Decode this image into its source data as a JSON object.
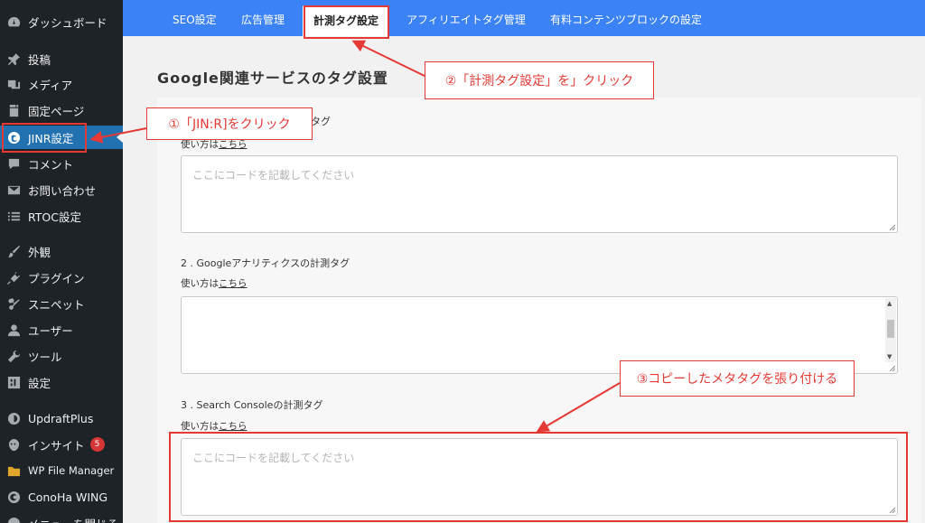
{
  "sidebar": {
    "items": [
      {
        "label": "ダッシュボード",
        "icon": "dashboard-icon"
      },
      {
        "label": "投稿",
        "icon": "pin-icon"
      },
      {
        "label": "メディア",
        "icon": "media-icon"
      },
      {
        "label": "固定ページ",
        "icon": "page-icon"
      },
      {
        "label": "JINR設定",
        "icon": "jinr-icon"
      },
      {
        "label": "コメント",
        "icon": "comment-icon"
      },
      {
        "label": "お問い合わせ",
        "icon": "mail-icon"
      },
      {
        "label": "RTOC設定",
        "icon": "list-icon"
      },
      {
        "label": "外観",
        "icon": "brush-icon"
      },
      {
        "label": "プラグイン",
        "icon": "plugin-icon"
      },
      {
        "label": "スニペット",
        "icon": "scissors-icon"
      },
      {
        "label": "ユーザー",
        "icon": "user-icon"
      },
      {
        "label": "ツール",
        "icon": "wrench-icon"
      },
      {
        "label": "設定",
        "icon": "settings-icon"
      },
      {
        "label": "UpdraftPlus",
        "icon": "updraft-icon"
      },
      {
        "label": "インサイト",
        "icon": "insight-icon",
        "badge": "5"
      },
      {
        "label": "WP File Manager",
        "icon": "folder-icon"
      },
      {
        "label": "ConoHa WING",
        "icon": "conoha-icon"
      },
      {
        "label": "メニューを閉じる",
        "icon": "collapse-icon"
      }
    ]
  },
  "tabs": [
    {
      "label": "SEO設定"
    },
    {
      "label": "広告管理"
    },
    {
      "label": "計測タグ設定"
    },
    {
      "label": "アフィリエイトタグ管理"
    },
    {
      "label": "有料コンテンツブロックの設定"
    }
  ],
  "main": {
    "title": "Google関連サービスのタグ設置",
    "section1_label_partial": "タグ",
    "section1_howto_partial": "使い方は",
    "section1_howto_link": "こちら",
    "section2_label": "2 . Googleアナリティクスの計測タグ",
    "section3_label": "3 . Search Consoleの計測タグ",
    "howto_text": "使い方は",
    "howto_link": "こちら",
    "textarea_placeholder": "ここにコードを記載してください"
  },
  "annotations": {
    "step1": "①「JIN:R]をクリック",
    "step2": "②「計測タグ設定」を」クリック",
    "step3": "③コピーしたメタタグを張り付ける",
    "color": "#e53935"
  },
  "colors": {
    "sidebar_bg": "#1d2327",
    "sidebar_active": "#2271b1",
    "tabbar_bg": "#3b82f6",
    "accent_red": "#e53935"
  }
}
